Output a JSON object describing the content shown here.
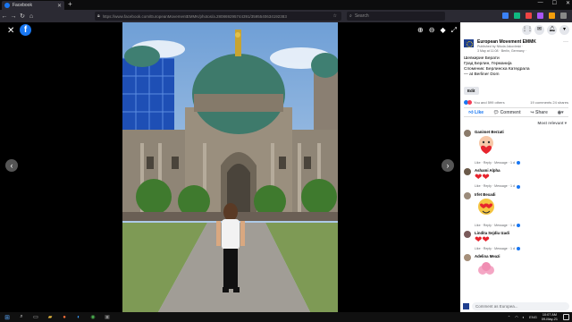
{
  "browser": {
    "tab_title": "Facebook",
    "url": "https://www.facebook.com/EuropeanMovementEMMK/photos/a.280869295744391/3595540634192383",
    "search_placeholder": "Search"
  },
  "viewer": {
    "close_glyph": "✕",
    "logo_letter": "f",
    "prev_glyph": "‹",
    "next_glyph": "›"
  },
  "panel": {
    "page_name": "European Movement EMMK",
    "published_by": "Published by Nikola Jakovleski ·",
    "post_date": "3 May at 11:08 · Berlin, Germany ·",
    "post_lines": [
      "Шевкирие Берати",
      "Град Берлин, Германија",
      "Споменик: Берлинска Катедрала",
      "— at Berliner Dom"
    ],
    "edit_label": "Edit",
    "reactions_text": "You and 599 others",
    "comments_count": "19 comments",
    "shares_count": "24 shares",
    "like_label": "Like",
    "comment_label": "Comment",
    "share_label": "Share",
    "sort_label": "Most relevant ▾",
    "comments": [
      {
        "name": "Ganimet Berzati",
        "kind": "sticker",
        "links": "Like · Reply · Message · 1 d"
      },
      {
        "name": "Ashami Alpha",
        "kind": "hearts",
        "links": "Like · Reply · Message · 1 d"
      },
      {
        "name": "Irfet Bexadi",
        "kind": "sticker",
        "links": "Like · Reply · Message · 1 d"
      },
      {
        "name": "Lindita Sejdiu Izadi",
        "kind": "hearts",
        "links": "Like · Reply · Message · 1 d"
      },
      {
        "name": "Adelina Meazi",
        "kind": "sticker",
        "links": ""
      }
    ],
    "comment_placeholder": "Comment as Europea..."
  },
  "taskbar": {
    "time": "10:07 AM",
    "date": "09-May-21",
    "lang": "ENG"
  },
  "colors": {
    "facebook_blue": "#1877f2",
    "love_red": "#f33e58",
    "panel_bg": "#ffffff",
    "viewer_bg": "#000000"
  }
}
